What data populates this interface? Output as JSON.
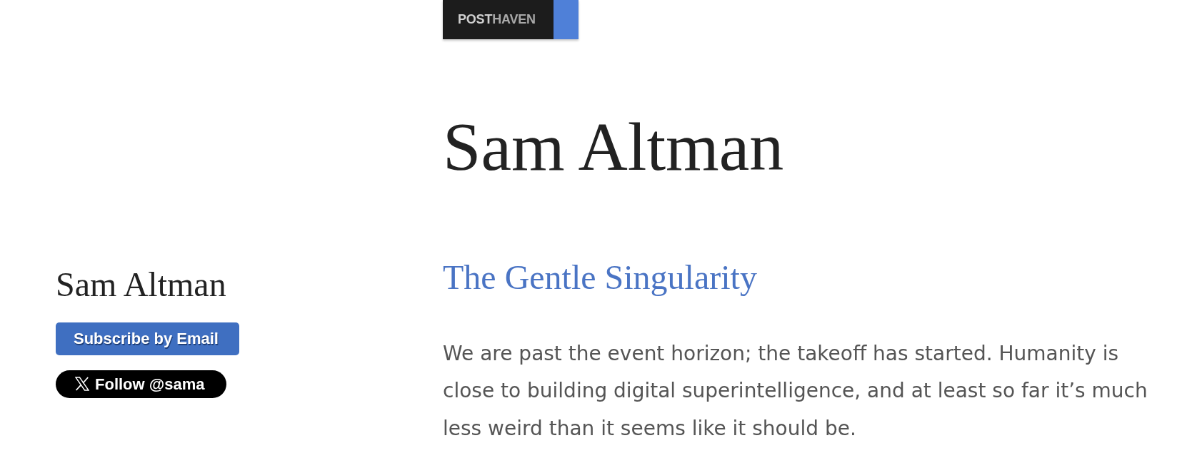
{
  "topbar": {
    "logo": [
      {
        "text": "POST",
        "kind": "strong"
      },
      {
        "text": "HAVEN",
        "kind": "muted"
      }
    ]
  },
  "site_title": "Sam Altman",
  "sidebar": {
    "author_name": "Sam Altman",
    "buttons": [
      {
        "kind": "subscribe",
        "label": "Subscribe by Email"
      },
      {
        "kind": "follow",
        "label": "Follow @sama"
      }
    ]
  },
  "post": {
    "title": "The Gentle Singularity",
    "body": "We are past the event horizon; the takeoff has started. Humanity is close to building digital superintelligence, and at least so far it’s much less weird than it seems like it should be."
  }
}
